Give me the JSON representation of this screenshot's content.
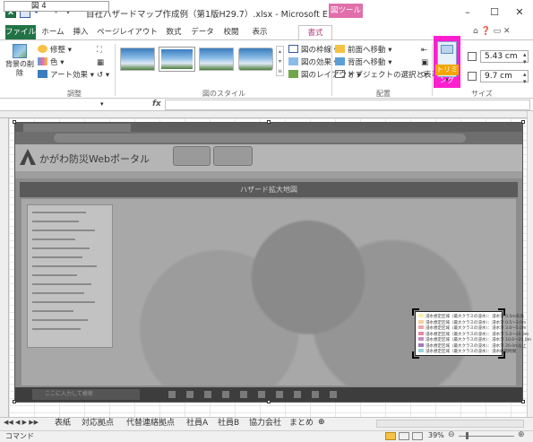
{
  "window": {
    "title": "自社ハザードマップ作成例（第1版H29.7）.xlsx - Microsoft E...",
    "context_tab_title": "図ツール"
  },
  "tabs": {
    "file": "ファイル",
    "home": "ホーム",
    "insert": "挿入",
    "pagelayout": "ページレイアウト",
    "formulas": "数式",
    "data": "データ",
    "review": "校閲",
    "view": "表示",
    "format": "書式"
  },
  "ribbon": {
    "remove_bg": "背景の削除",
    "adjust": {
      "corrections": "修整",
      "color": "色",
      "artistic": "アート効果",
      "label": "調整"
    },
    "picture_styles": {
      "border": "図の枠線",
      "effects": "図の効果",
      "layout": "図のレイアウト",
      "label": "図のスタイル"
    },
    "arrange": {
      "bring_forward": "前面へ移動",
      "send_backward": "背面へ移動",
      "selection_pane": "オブジェクトの選択と表示",
      "label": "配置"
    },
    "size": {
      "crop": "トリミング",
      "height": "5.43 cm",
      "width": "9.7 cm",
      "label": "サイズ"
    }
  },
  "formula_bar": {
    "name_box": "図 4",
    "fx": "fx"
  },
  "picture": {
    "portal_title": "かがわ防災Webポータル",
    "panel_title": "ハザード拡大地図",
    "taskbar_search": "ここに入力して検索",
    "legend": [
      {
        "text": "浸水想定区域（最大クラスの浸水）：浸水深 0.5m未満",
        "color": "#f7f1a6"
      },
      {
        "text": "浸水想定区域（最大クラスの浸水）：浸水深 0.5〜3.0m",
        "color": "#f5d1a0"
      },
      {
        "text": "浸水想定区域（最大クラスの浸水）：浸水深 3.0〜5.0m",
        "color": "#f1a7a7"
      },
      {
        "text": "浸水想定区域（最大クラスの浸水）：浸水深 5.0〜10.0m",
        "color": "#e38aa5"
      },
      {
        "text": "浸水想定区域（最大クラスの浸水）：浸水深 10.0〜20.0m",
        "color": "#c98ac6"
      },
      {
        "text": "浸水想定区域（最大クラスの浸水）：浸水深 20.0m以上",
        "color": "#a07ac2"
      },
      {
        "text": "浸水想定区域（最大クラスの浸水）：浸水継続時間",
        "color": "#9ad3e0"
      }
    ]
  },
  "sheets": [
    "表紙",
    "対応拠点",
    "代替連絡拠点",
    "社員A",
    "社員B",
    "協力会社",
    "まとめ"
  ],
  "status": {
    "mode": "コマンド",
    "zoom": "39%"
  },
  "colors": {
    "excel_green": "#217346",
    "context_pink": "#e06fab",
    "highlight_magenta": "#ff1fcf"
  }
}
